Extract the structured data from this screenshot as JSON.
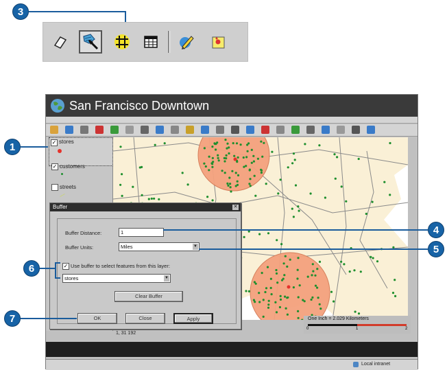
{
  "callouts": {
    "one": "1",
    "three": "3",
    "four": "4",
    "five": "5",
    "six": "6",
    "seven": "7"
  },
  "mini_toolbar": {
    "icons": [
      "eraser-icon",
      "select-features-icon",
      "grid-icon",
      "table-icon",
      "pencil-icon",
      "sticky-note-icon"
    ],
    "pressed": "select-features-icon"
  },
  "window": {
    "title": "San Francisco Downtown"
  },
  "toc": {
    "layers": [
      {
        "name": "stores",
        "checked": true,
        "symbol_color": "#e5322b"
      },
      {
        "name": "customers",
        "checked": true,
        "symbol_color": "#1f8f2e"
      },
      {
        "name": "streets",
        "checked": false,
        "symbol_color": "#c8d27a"
      }
    ]
  },
  "map": {
    "land_color": "#faf0d6",
    "water_color": "#ffffff",
    "buffer_color": "#f4a27e",
    "point_color": "#1f8f2e",
    "store_color": "#e5322b"
  },
  "scale": {
    "text": "One Inch = 2.029 Kilometers",
    "ticks": [
      "0",
      "1",
      "2"
    ]
  },
  "coords": "1, 31 192",
  "status": {
    "zone": "Local intranet"
  },
  "dialog": {
    "title": "Buffer",
    "close_glyph": "✕",
    "distance_label": "Buffer Distance:",
    "distance_value": "1",
    "units_label": "Buffer Units:",
    "units_value": "Miles",
    "use_buffer_label": "Use buffer to select features from this layer:",
    "use_buffer_checked": true,
    "layer_value": "stores",
    "clear_buffer_label": "Clear Buffer",
    "ok_label": "OK",
    "close_label": "Close",
    "apply_label": "Apply"
  }
}
